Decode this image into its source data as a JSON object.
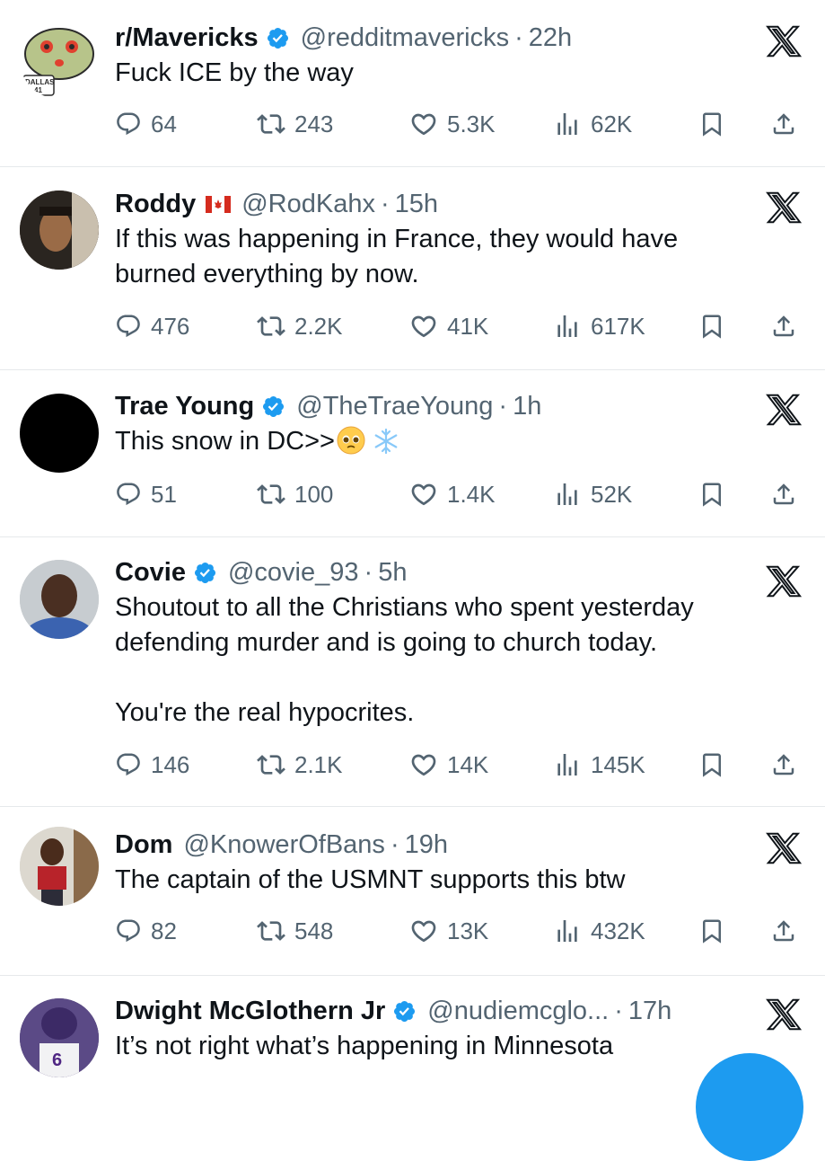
{
  "colors": {
    "text": "#0f1419",
    "muted": "#536471",
    "divider": "#e6e9eb",
    "verified": "#1d9bf0",
    "fab": "#1d9bf0"
  },
  "icons": [
    "reply-icon",
    "retweet-icon",
    "like-icon",
    "views-icon",
    "bookmark-icon",
    "share-icon",
    "x-logo-icon",
    "verified-badge-icon",
    "canada-flag-icon",
    "pleading-face-emoji",
    "snowflake-emoji"
  ],
  "tweets": [
    {
      "name": "r/Mavericks",
      "verified": true,
      "flag": false,
      "handle": "@redditmavericks",
      "sep": "·",
      "time": "22h",
      "text": "Fuck ICE by the way",
      "replies": "64",
      "retweets": "243",
      "likes": "5.3K",
      "views": "62K"
    },
    {
      "name": "Roddy",
      "verified": false,
      "flag": true,
      "handle": "@RodKahx",
      "sep": "·",
      "time": "15h",
      "text": "If this was happening in France, they would have\nburned everything by now.",
      "replies": "476",
      "retweets": "2.2K",
      "likes": "41K",
      "views": "617K"
    },
    {
      "name": "Trae Young",
      "verified": true,
      "flag": false,
      "handle": "@TheTraeYoung",
      "sep": "·",
      "time": "1h",
      "text": "This snow in DC>>",
      "replies": "51",
      "retweets": "100",
      "likes": "1.4K",
      "views": "52K"
    },
    {
      "name": "Covie",
      "verified": true,
      "flag": false,
      "handle": "@covie_93",
      "sep": "·",
      "time": "5h",
      "text": "Shoutout to all the Christians who spent yesterday\ndefending murder and is going to church today.\n\nYou're the real hypocrites.",
      "replies": "146",
      "retweets": "2.1K",
      "likes": "14K",
      "views": "145K"
    },
    {
      "name": "Dom",
      "verified": false,
      "flag": false,
      "handle": "@KnowerOfBans",
      "sep": "·",
      "time": "19h",
      "text": "The captain of the USMNT supports this btw",
      "replies": "82",
      "retweets": "548",
      "likes": "13K",
      "views": "432K"
    },
    {
      "name": "Dwight McGlothern Jr",
      "verified": true,
      "flag": false,
      "handle": "@nudiemcglo...",
      "sep": "·",
      "time": "17h",
      "text": "It’s not right what’s happening in Minnesota",
      "replies": "",
      "retweets": "",
      "likes": "",
      "views": ""
    }
  ],
  "avatar_badges": {
    "mavs_logo_text": "DALLAS",
    "mavs_number": "41",
    "jersey_number": "6"
  }
}
